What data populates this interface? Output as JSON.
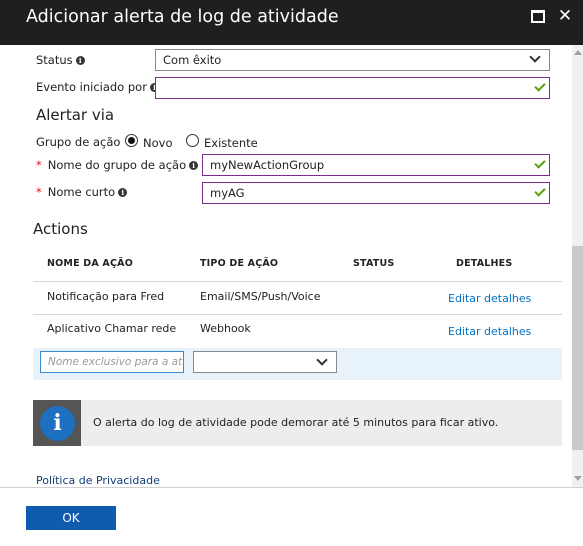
{
  "window": {
    "title": "Adicionar alerta de log de atividade"
  },
  "form": {
    "status": {
      "label": "Status",
      "value": "Com êxito"
    },
    "evento": {
      "label": "Evento iniciado por",
      "value": ""
    }
  },
  "alertar_via": {
    "heading": "Alertar via",
    "grupo_de_acao": {
      "label": "Grupo de ação",
      "option_new": "Novo",
      "option_existing": "Existente",
      "selected": "Novo"
    },
    "nome_grupo": {
      "label": "Nome do grupo de ação",
      "value": "myNewActionGroup"
    },
    "nome_curto": {
      "label": "Nome curto",
      "value": "myAG"
    }
  },
  "actions": {
    "heading": "Actions",
    "columns": [
      "NOME DA AÇÃO",
      "TIPO DE AÇÃO",
      "STATUS",
      "DETALHES"
    ],
    "rows": [
      {
        "name": "Notificação para Fred",
        "type": "Email/SMS/Push/Voice",
        "status": "",
        "details": "Editar detalhes"
      },
      {
        "name": "Aplicativo Chamar rede",
        "type": "Webhook",
        "status": "",
        "details": "Editar detalhes"
      }
    ],
    "new_row": {
      "name_placeholder": "Nome exclusivo para a at",
      "type_value": ""
    }
  },
  "info": {
    "message": "O alerta do log de atividade pode demorar até 5 minutos para ficar ativo."
  },
  "footer": {
    "privacy": "Política de Privacidade",
    "ok": "OK"
  },
  "colors": {
    "titlebar": "#1f1f1f",
    "accent": "#0f5bb0",
    "link": "#0072c6",
    "valid_border": "#7a2d8c",
    "check": "#57a300",
    "required": "#e00b1c"
  }
}
